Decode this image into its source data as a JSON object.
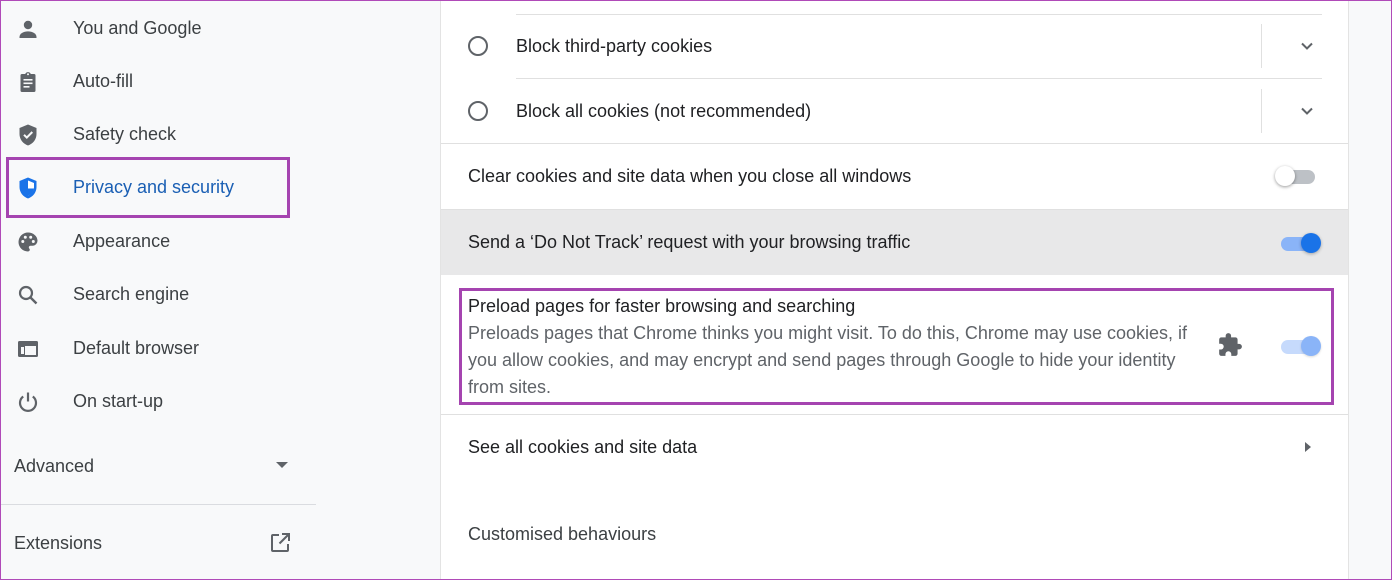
{
  "sidebar": {
    "items": [
      {
        "label": "You and Google",
        "icon": "person-icon"
      },
      {
        "label": "Auto-fill",
        "icon": "clipboard-icon"
      },
      {
        "label": "Safety check",
        "icon": "shield-check-icon"
      },
      {
        "label": "Privacy and security",
        "icon": "shield-half-icon",
        "active": true
      },
      {
        "label": "Appearance",
        "icon": "palette-icon"
      },
      {
        "label": "Search engine",
        "icon": "search-icon"
      },
      {
        "label": "Default browser",
        "icon": "browser-window-icon"
      },
      {
        "label": "On start-up",
        "icon": "power-icon"
      }
    ],
    "advanced_label": "Advanced",
    "extensions_label": "Extensions"
  },
  "main": {
    "cookie_options": [
      {
        "label": "Block third-party cookies",
        "selected": false
      },
      {
        "label": "Block all cookies (not recommended)",
        "selected": false
      }
    ],
    "clear_on_exit": {
      "label": "Clear cookies and site data when you close all windows",
      "enabled": false
    },
    "do_not_track": {
      "label": "Send a ‘Do Not Track’ request with your browsing traffic",
      "enabled": true
    },
    "preload": {
      "title": "Preload pages for faster browsing and searching",
      "description": "Preloads pages that Chrome thinks you might visit. To do this, Chrome may use cookies, if you allow cookies, and may encrypt and send pages through Google to hide your identity from sites.",
      "enabled": true,
      "managed_by_extension": true
    },
    "see_all": {
      "label": "See all cookies and site data"
    },
    "customised_behaviours": {
      "title": "Customised behaviours"
    }
  },
  "colors": {
    "accent": "#1a73e8",
    "active_text": "#1a5fb4",
    "highlight_border": "#a544b0",
    "row_hover_bg": "#e8e8e9"
  }
}
